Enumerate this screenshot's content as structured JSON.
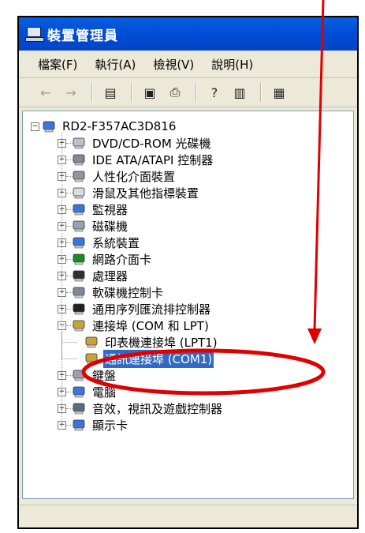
{
  "window": {
    "title": "裝置管理員"
  },
  "menu": [
    {
      "label": "檔案(F)"
    },
    {
      "label": "執行(A)"
    },
    {
      "label": "檢視(V)"
    },
    {
      "label": "說明(H)"
    }
  ],
  "toolbar": {
    "buttons": [
      {
        "icon": "back-arrow-icon",
        "glyph": "←"
      },
      {
        "icon": "forward-arrow-icon",
        "glyph": "→"
      },
      {
        "icon": "show-hide-tree-icon",
        "glyph": "▤"
      },
      {
        "icon": "properties-icon",
        "glyph": "▣"
      },
      {
        "icon": "print-icon",
        "glyph": "⎙"
      },
      {
        "icon": "help-icon",
        "glyph": "?"
      },
      {
        "icon": "view-icon",
        "glyph": "▥"
      },
      {
        "icon": "scan-hardware-icon",
        "glyph": "▦"
      }
    ]
  },
  "tree": {
    "root": "RD2-F357AC3D816",
    "items": [
      {
        "label": "DVD/CD-ROM 光碟機",
        "icon": "dvd-drive-icon",
        "expander": "+"
      },
      {
        "label": "IDE ATA/ATAPI 控制器",
        "icon": "ide-controller-icon",
        "expander": "+"
      },
      {
        "label": "人性化介面裝置",
        "icon": "hid-device-icon",
        "expander": "+"
      },
      {
        "label": "滑鼠及其他指標裝置",
        "icon": "mouse-icon",
        "expander": "+"
      },
      {
        "label": "監視器",
        "icon": "monitor-icon",
        "expander": "+"
      },
      {
        "label": "磁碟機",
        "icon": "disk-drive-icon",
        "expander": "+"
      },
      {
        "label": "系統裝置",
        "icon": "system-device-icon",
        "expander": "+"
      },
      {
        "label": "網路介面卡",
        "icon": "network-adapter-icon",
        "expander": "+"
      },
      {
        "label": "處理器",
        "icon": "processor-icon",
        "expander": "+"
      },
      {
        "label": "軟碟機控制卡",
        "icon": "floppy-controller-icon",
        "expander": "+"
      },
      {
        "label": "通用序列匯流排控制器",
        "icon": "usb-controller-icon",
        "expander": "+"
      },
      {
        "label": "連接埠 (COM 和 LPT)",
        "icon": "port-icon",
        "expander": "-"
      }
    ],
    "ports_children": [
      {
        "label": "印表機連接埠 (LPT1)",
        "icon": "printer-port-icon"
      },
      {
        "label": "通訊連接埠 (COM1)",
        "icon": "com-port-icon",
        "selected": true
      }
    ],
    "items_after": [
      {
        "label": "鍵盤",
        "icon": "keyboard-icon",
        "expander": "+"
      },
      {
        "label": "電腦",
        "icon": "computer-icon",
        "expander": "+"
      },
      {
        "label": "音效，視訊及遊戲控制器",
        "icon": "sound-icon",
        "expander": "+"
      },
      {
        "label": "顯示卡",
        "icon": "display-adapter-icon",
        "expander": "+"
      }
    ]
  },
  "colors": {
    "title_bar": "#0050d8",
    "selection": "#316ac5",
    "annotation": "#e00000"
  }
}
